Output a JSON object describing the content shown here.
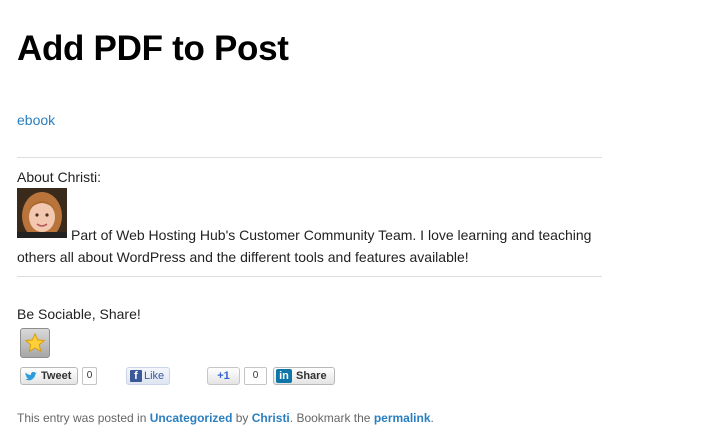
{
  "post": {
    "title": "Add PDF to Post",
    "attachment_link": "ebook"
  },
  "author_box": {
    "heading": "About Christi:",
    "bio": "Part of Web Hosting Hub's Customer Community Team. I love learning and teaching others all about WordPress and the different tools and features available!"
  },
  "share": {
    "heading": "Be Sociable, Share!",
    "tweet_label": "Tweet",
    "tweet_count": "0",
    "like_label": "Like",
    "gplus_label": "+1",
    "gplus_count": "0",
    "linkedin_label": "Share",
    "linkedin_logo": "in"
  },
  "footer": {
    "prefix": "This entry was posted in ",
    "category": "Uncategorized",
    "by": " by ",
    "author": "Christi",
    "middle": ". Bookmark the ",
    "permalink": "permalink",
    "suffix": "."
  },
  "colors": {
    "link": "#2a7fc0",
    "divider": "#dddddd",
    "twitter": "#2d9cdb",
    "facebook": "#3b5998",
    "linkedin": "#0e76a8"
  },
  "icons": [
    "star-icon",
    "twitter-bird-icon",
    "facebook-icon",
    "google-plus-icon",
    "linkedin-icon"
  ]
}
